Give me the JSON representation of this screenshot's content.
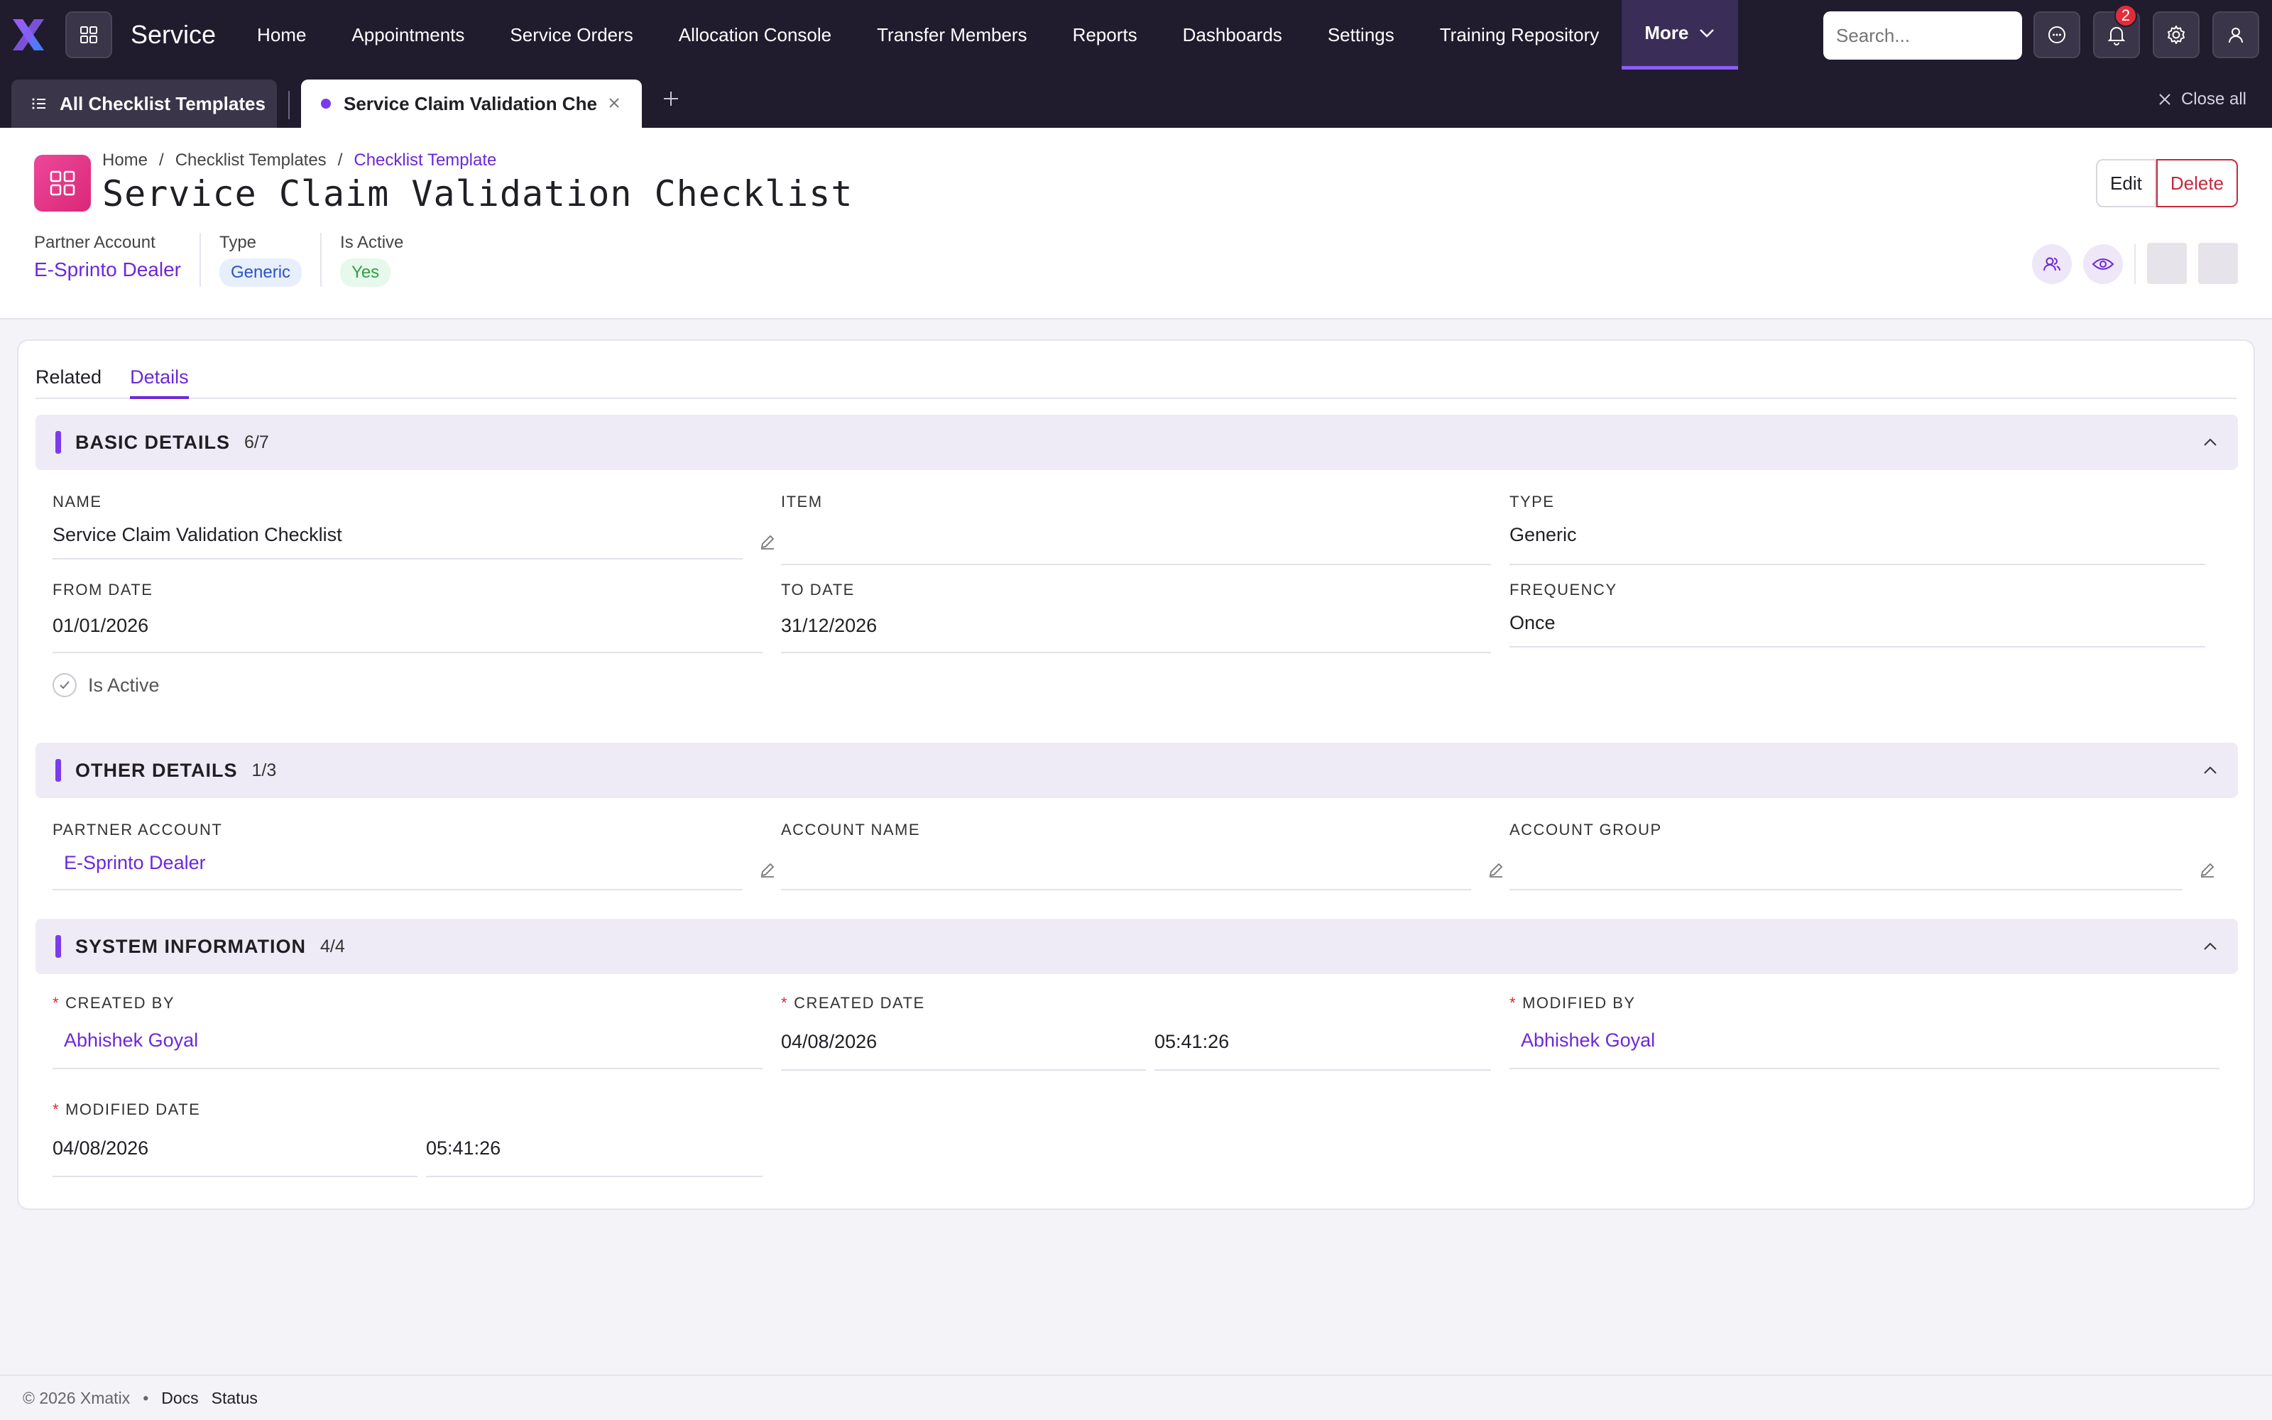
{
  "app": {
    "name": "Service",
    "logo_icon": "x-logo-icon",
    "accent_color": "#7c3aed",
    "nav_bg": "#201b2d"
  },
  "nav": {
    "items": [
      "Home",
      "Appointments",
      "Service Orders",
      "Allocation Console",
      "Transfer Members",
      "Reports",
      "Dashboards",
      "Settings",
      "Training Repository"
    ],
    "more_label": "More"
  },
  "search": {
    "placeholder": "Search..."
  },
  "notifications": {
    "count": "2"
  },
  "tabs": {
    "all_label": "All Checklist Templates",
    "active_label": "Service Claim Validation Che",
    "close_all_label": "Close all"
  },
  "record": {
    "breadcrumb": [
      "Home",
      "Checklist Templates",
      "Checklist Template"
    ],
    "title": "Service Claim Validation Checklist",
    "highlights": {
      "partner_account_label": "Partner Account",
      "partner_account_value": "E-Sprinto Dealer",
      "type_label": "Type",
      "type_value": "Generic",
      "is_active_label": "Is Active",
      "is_active_value": "Yes"
    },
    "edit_label": "Edit",
    "delete_label": "Delete"
  },
  "detail_tabs": {
    "related": "Related",
    "details": "Details"
  },
  "sections": {
    "basic": {
      "title": "BASIC DETAILS",
      "count": "6/7",
      "name_label": "Name",
      "name_value": "Service Claim Validation Checklist",
      "item_label": "Item",
      "item_value": "",
      "type_label": "Type",
      "type_value": "Generic",
      "from_label": "From Date",
      "from_value": "01/01/2026",
      "to_label": "To Date",
      "to_value": "31/12/2026",
      "freq_label": "Frequency",
      "freq_value": "Once",
      "is_active_label": "Is Active"
    },
    "other": {
      "title": "OTHER DETAILS",
      "count": "1/3",
      "partner_label": "Partner Account",
      "partner_value": "E-Sprinto Dealer",
      "account_name_label": "Account Name",
      "account_name_value": "",
      "account_group_label": "Account Group",
      "account_group_value": ""
    },
    "system": {
      "title": "SYSTEM INFORMATION",
      "count": "4/4",
      "created_by_label": "Created By",
      "created_by_value": "Abhishek Goyal",
      "created_date_label": "Created Date",
      "created_date_value": "04/08/2026",
      "created_time_value": "05:41:26",
      "modified_by_label": "Modified By",
      "modified_by_value": "Abhishek Goyal",
      "modified_date_label": "Modified Date",
      "modified_date_value": "04/08/2026",
      "modified_time_value": "05:41:26"
    }
  },
  "footer": {
    "copyright": "© 2026 Xmatix",
    "separator": "•",
    "docs": "Docs",
    "status": "Status"
  }
}
